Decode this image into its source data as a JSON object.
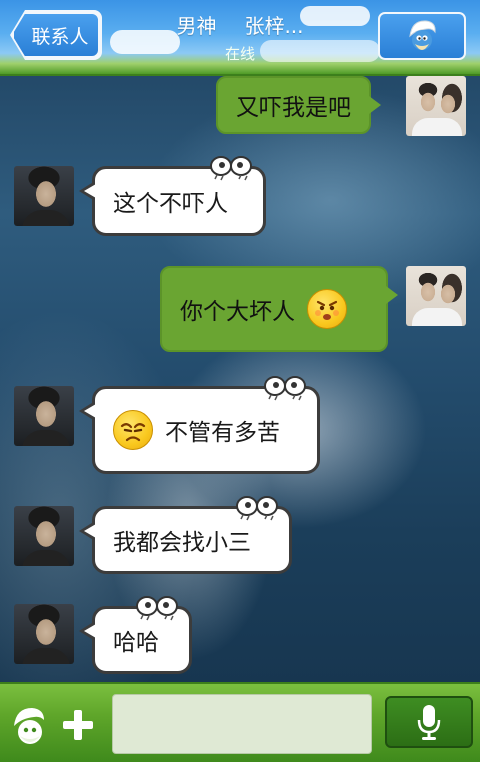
{
  "header": {
    "back_label": "联系人",
    "contact_name": "男神",
    "contact_second_name": "张梓...",
    "status": "在线"
  },
  "messages": [
    {
      "side": "sent",
      "text": "又吓我是吧"
    },
    {
      "side": "received",
      "text": "这个不吓人"
    },
    {
      "side": "sent",
      "text": "你个大坏人",
      "emoji": "angry-face-emoji"
    },
    {
      "side": "received",
      "text": "不管有多苦",
      "emoji": "grumpy-face-emoji"
    },
    {
      "side": "received",
      "text": "我都会找小三"
    },
    {
      "side": "received",
      "text": "哈哈"
    }
  ],
  "bottom": {
    "input_value": "",
    "icons": [
      "smurf-mascot-icon",
      "plus-icon",
      "microphone-icon"
    ]
  },
  "colors": {
    "header_blue": "#3b94e6",
    "grass_green": "#4f9b27",
    "sent_bubble": "#6aa532",
    "received_bubble": "#ffffff"
  }
}
